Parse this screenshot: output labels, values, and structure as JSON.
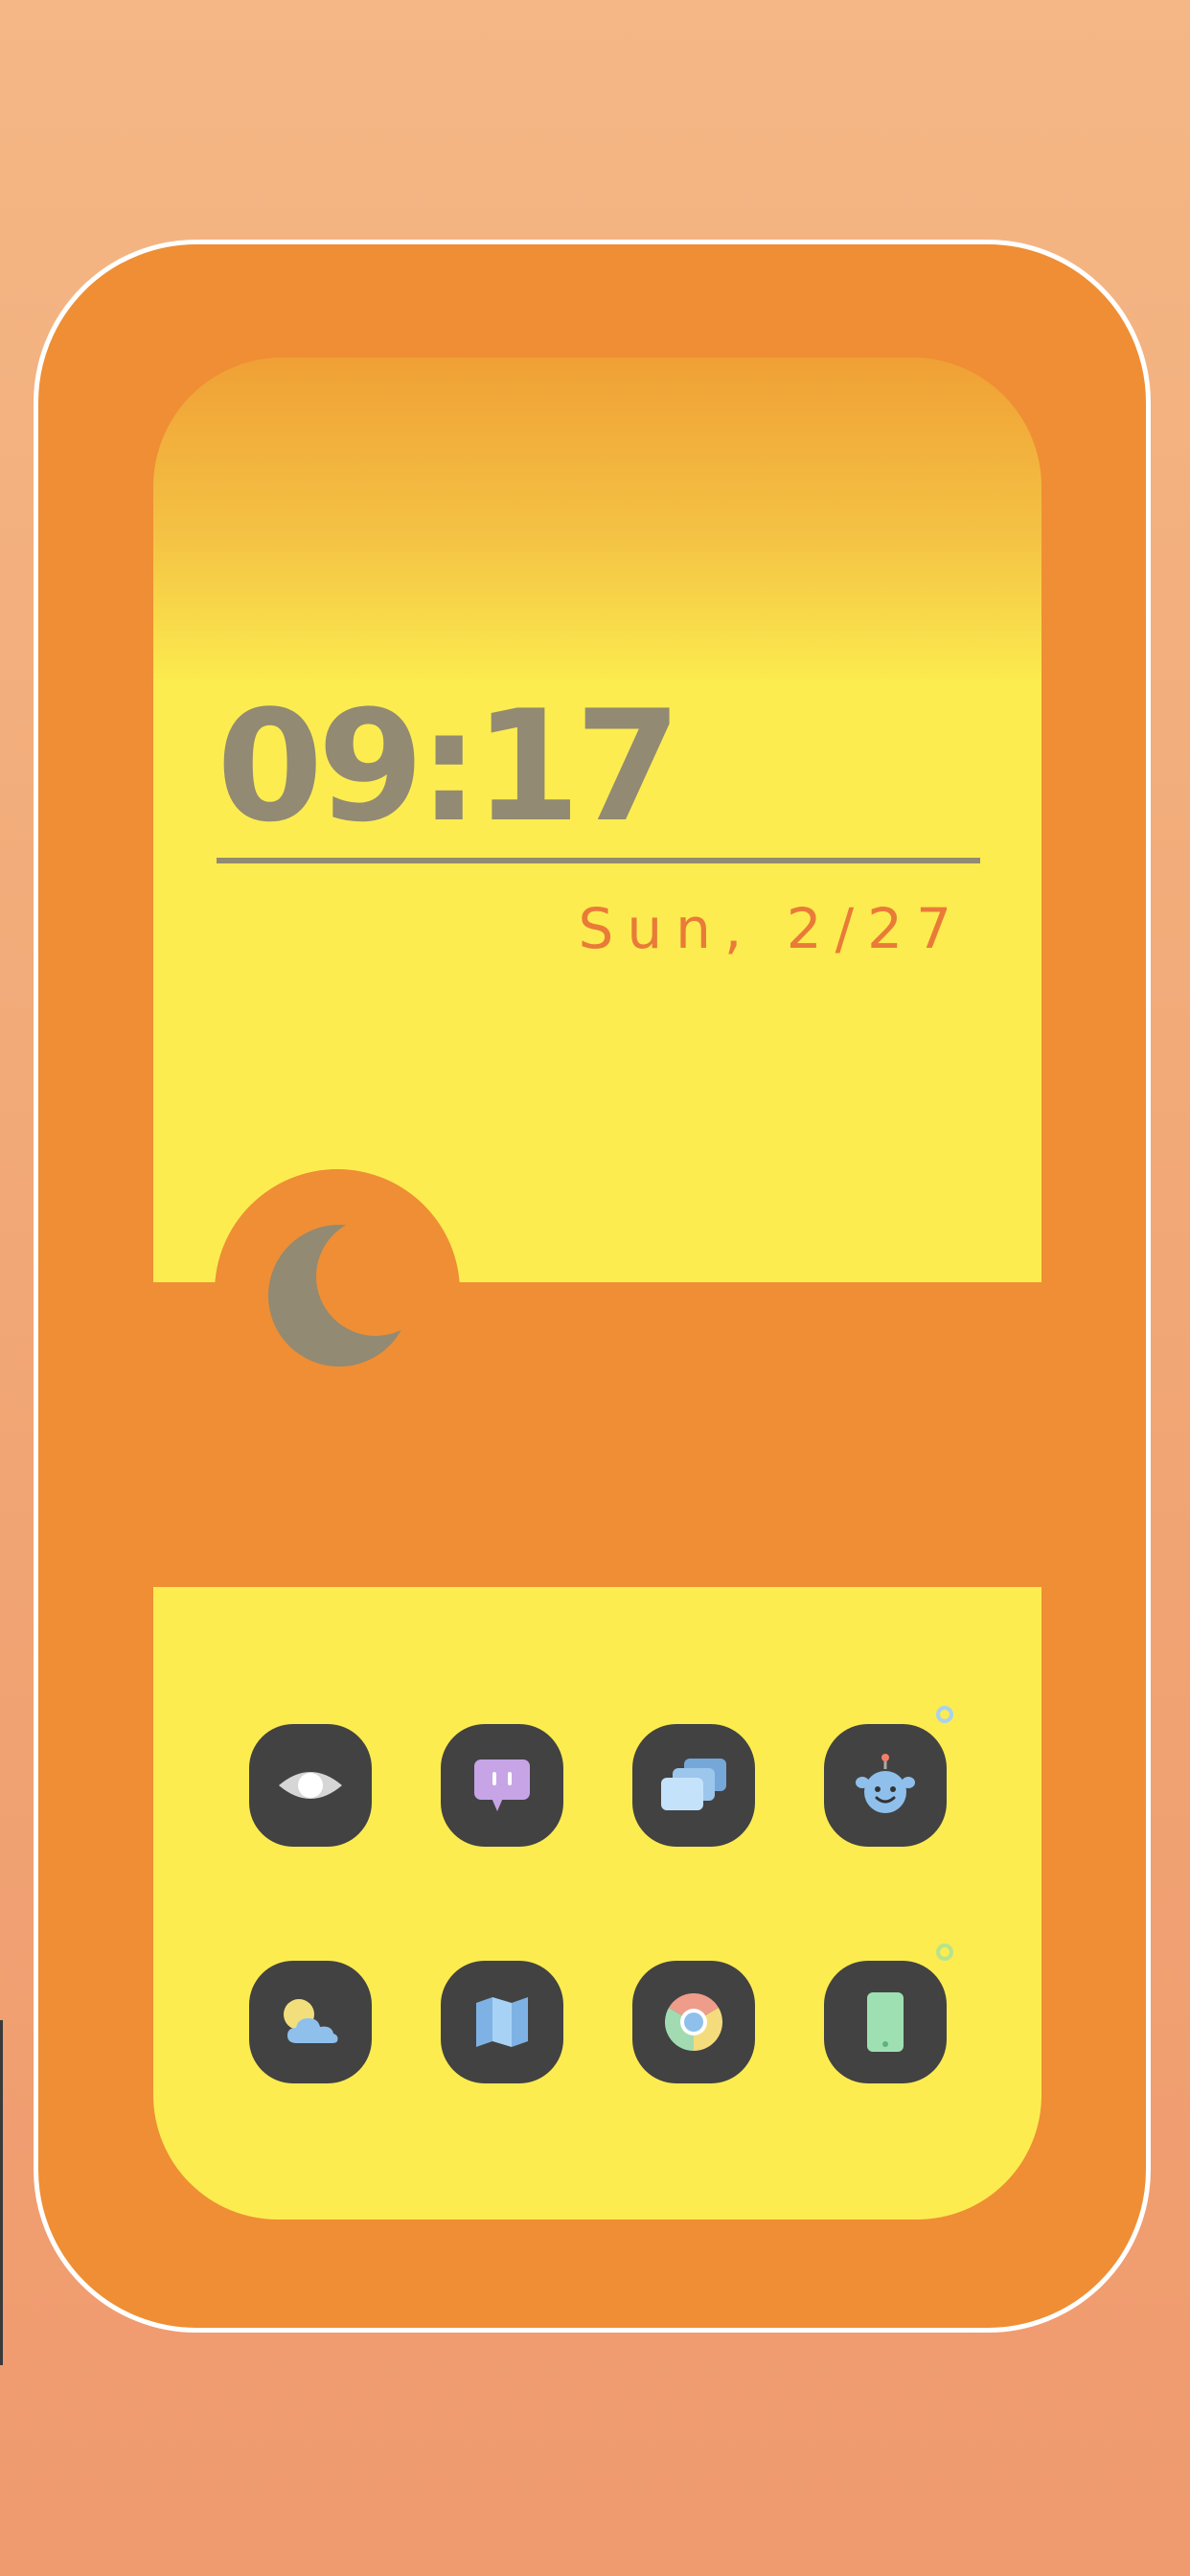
{
  "clock": {
    "time": "09:17",
    "date": "Sun, 2/27"
  },
  "weather": {
    "icon": "crescent-moon-icon"
  },
  "apps": [
    {
      "icon": "eye-icon"
    },
    {
      "icon": "chat-icon"
    },
    {
      "icon": "layered-windows-icon"
    },
    {
      "icon": "robot-face-icon"
    },
    {
      "icon": "weather-icon"
    },
    {
      "icon": "map-icon"
    },
    {
      "icon": "chrome-icon"
    },
    {
      "icon": "phone-icon"
    }
  ],
  "colors": {
    "background": "#f3ad7c",
    "frame": "#ef8e34",
    "panel": "#fcec50",
    "clock_text": "#928a72",
    "date_text": "#ea7a38",
    "app_tile": "#424242"
  }
}
